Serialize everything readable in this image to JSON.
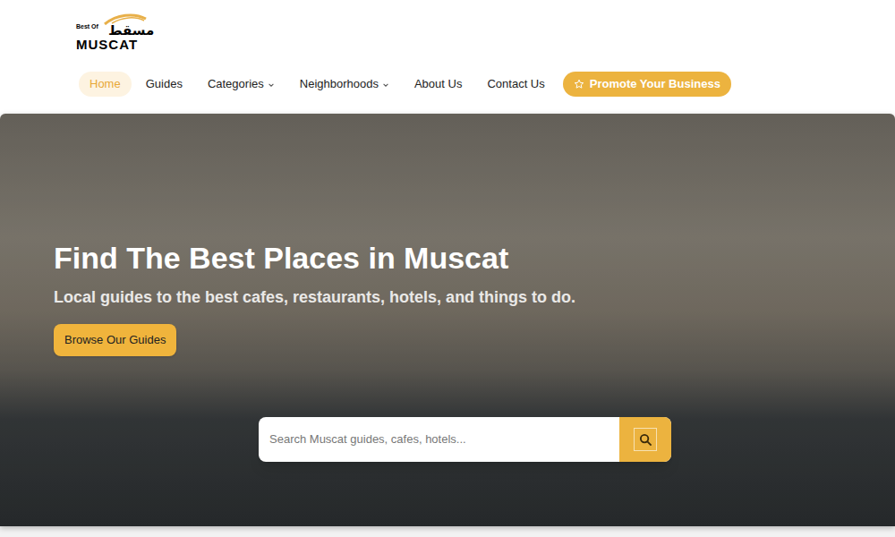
{
  "logo": {
    "top": "Best Of",
    "arabic": "مسقط",
    "main": "MUSCAT"
  },
  "nav": [
    {
      "label": "Home",
      "selected": true,
      "dropdown": false
    },
    {
      "label": "Guides",
      "selected": false,
      "dropdown": false
    },
    {
      "label": "Categories",
      "selected": false,
      "dropdown": true
    },
    {
      "label": "Neighborhoods",
      "selected": false,
      "dropdown": true
    },
    {
      "label": "About Us",
      "selected": false,
      "dropdown": false
    },
    {
      "label": "Contact Us",
      "selected": false,
      "dropdown": false
    }
  ],
  "cta": {
    "label": "Promote Your Business"
  },
  "hero": {
    "title": "Find The Best Places in Muscat",
    "subtitle": "Local guides to the best cafes, restaurants, hotels, and things to do.",
    "button": "Browse Our Guides"
  },
  "search": {
    "placeholder": "Search Muscat guides, cafes, hotels..."
  }
}
